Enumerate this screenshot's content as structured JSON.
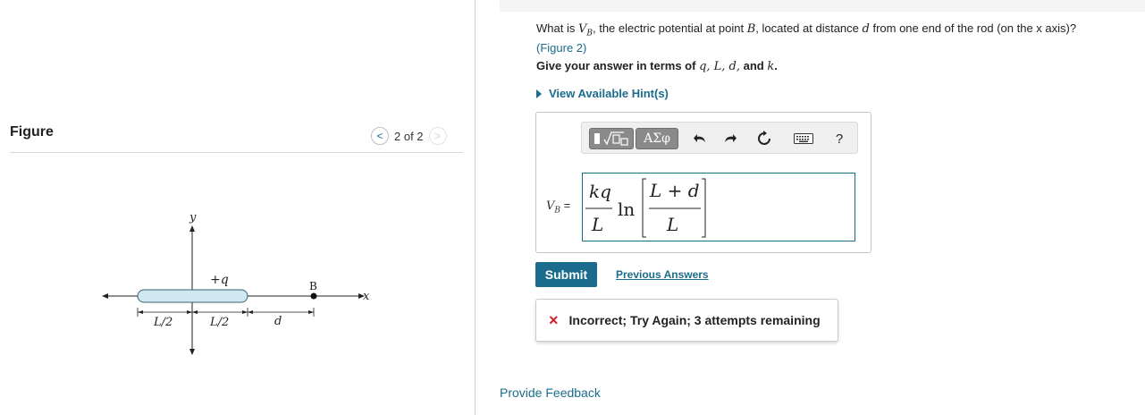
{
  "figure": {
    "title": "Figure",
    "nav_prev": "<",
    "nav_position": "2 of 2",
    "nav_next": ">",
    "labels": {
      "y_axis": "y",
      "x_axis": "x",
      "charge": "+q",
      "left_half": "L/2",
      "right_half": "L/2",
      "distance": "d",
      "point": "B"
    }
  },
  "question": {
    "prefix": "What is ",
    "var": "V",
    "var_sub": "B",
    "mid": ", the electric potential at point ",
    "point": "B",
    "mid2": ", located at distance ",
    "dist": "d",
    "suffix": " from one end of the rod (on the x axis)?",
    "figure_link": "(Figure 2)"
  },
  "instruction": {
    "prefix": "Give your answer in terms of ",
    "vars": "q, L, d,",
    "and": " and ",
    "k": "k",
    "end": "."
  },
  "hints_label": "View Available Hint(s)",
  "toolbar": {
    "templates_icon": "templates-icon",
    "symbols_label": "ΑΣφ",
    "undo_icon": "undo-icon",
    "redo_icon": "redo-icon",
    "reset_icon": "reset-icon",
    "keyboard_icon": "keyboard-icon",
    "help_label": "?"
  },
  "answer": {
    "label": "V",
    "label_sub": "B",
    "label_eq": " =",
    "numerator": "kq",
    "denominator": "L",
    "ln": "ln",
    "inner_numerator": "L + d",
    "inner_denominator": "L"
  },
  "submit_label": "Submit",
  "previous_answers_label": "Previous Answers",
  "feedback": {
    "icon": "×",
    "text": "Incorrect; Try Again; 3 attempts remaining"
  },
  "provide_feedback_label": "Provide Feedback",
  "colors": {
    "accent": "#1b6c8c",
    "error": "#d0232f",
    "rod_fill": "#cfe8f2"
  }
}
